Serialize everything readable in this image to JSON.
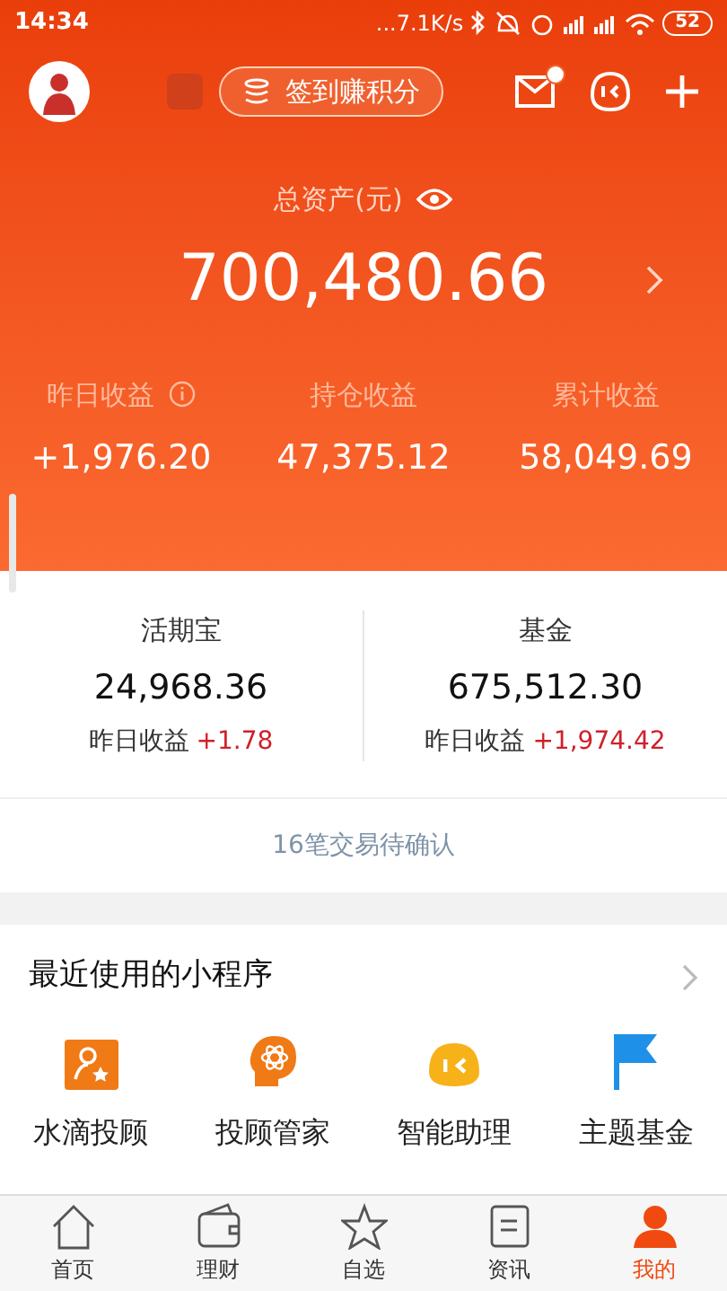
{
  "status_bar": {
    "time": "14:34",
    "speed": "...7.1K/s",
    "battery": "52"
  },
  "header": {
    "checkin_label": "签到赚积分",
    "mail_unread": true
  },
  "total": {
    "label": "总资产(元)",
    "amount": "700,480.66"
  },
  "earnings": [
    {
      "label": "昨日收益",
      "info": true,
      "value": "+1,976.20"
    },
    {
      "label": "持仓收益",
      "info": false,
      "value": "47,375.12"
    },
    {
      "label": "累计收益",
      "info": false,
      "value": "58,049.69"
    }
  ],
  "holdings": [
    {
      "name": "活期宝",
      "amount": "24,968.36",
      "yesterday_label": "昨日收益",
      "yesterday_value": "+1.78"
    },
    {
      "name": "基金",
      "amount": "675,512.30",
      "yesterday_label": "昨日收益",
      "yesterday_value": "+1,974.42"
    }
  ],
  "pending": "16笔交易待确认",
  "mini_programs": {
    "title": "最近使用的小程序",
    "items": [
      {
        "kind": "advisor",
        "label": "水滴投顾"
      },
      {
        "kind": "brain",
        "label": "投顾管家"
      },
      {
        "kind": "bot",
        "label": "智能助理"
      },
      {
        "kind": "flag",
        "label": "主题基金"
      }
    ]
  },
  "tab_bar": [
    {
      "kind": "home",
      "label": "首页",
      "selected": false
    },
    {
      "kind": "wallet",
      "label": "理财",
      "selected": false
    },
    {
      "kind": "star",
      "label": "自选",
      "selected": false
    },
    {
      "kind": "news",
      "label": "资讯",
      "selected": false
    },
    {
      "kind": "user",
      "label": "我的",
      "selected": true
    }
  ]
}
